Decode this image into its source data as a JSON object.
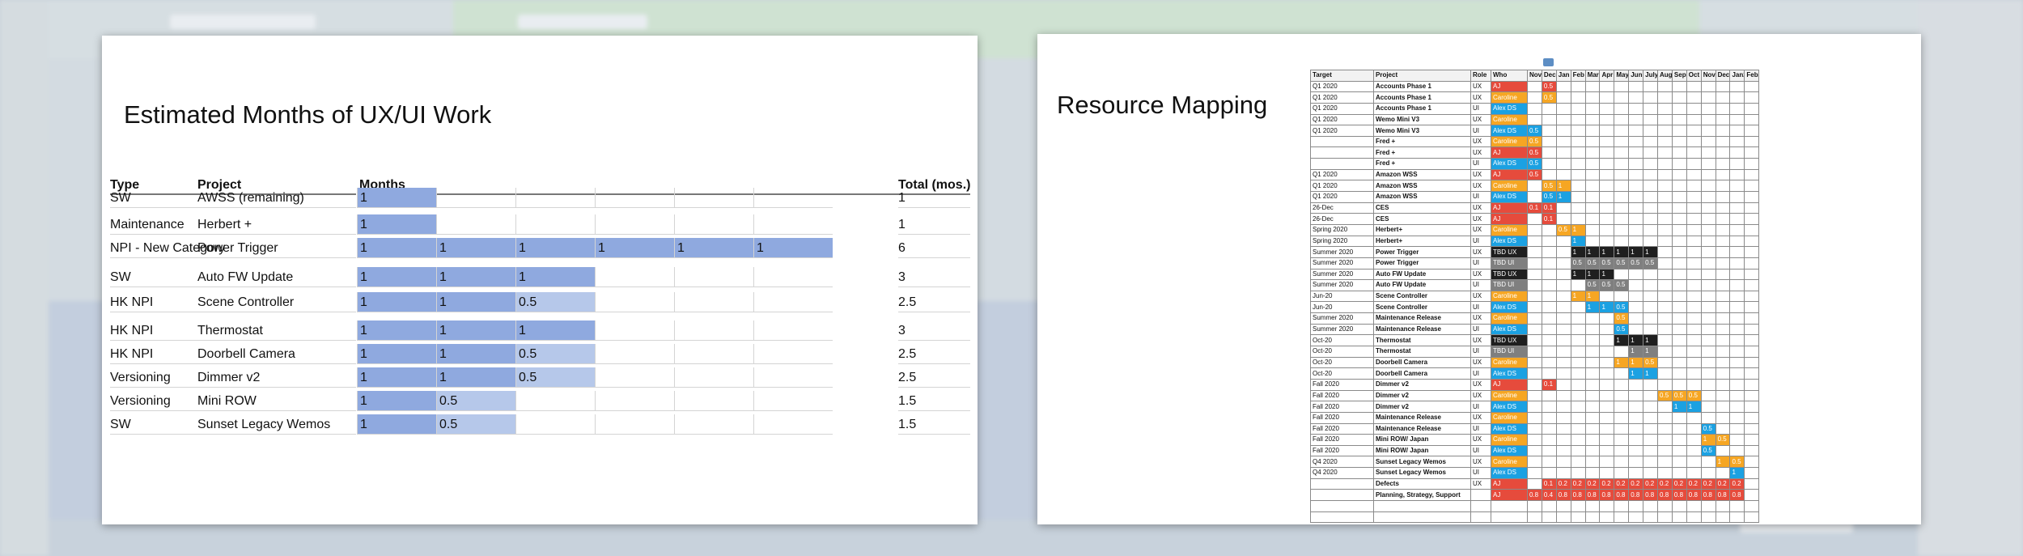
{
  "colors": {
    "red": "#e64b3c",
    "orange": "#f6a623",
    "blue": "#1ba1e2",
    "black": "#1f1f1f",
    "gray": "#7f7f7f",
    "month_full": "#8fa9df",
    "month_half": "#b6c8ea"
  },
  "icons": {
    "table_handle": "table-handle-icon"
  },
  "left_slide": {
    "title": "Estimated Months of UX/UI Work",
    "headers": {
      "type": "Type",
      "project": "Project",
      "months": "Months",
      "total": "Total (mos.)"
    },
    "rows": [
      {
        "type": "SW",
        "project": "AWSS (remaining)",
        "months": [
          "1"
        ],
        "total": "1"
      },
      {
        "type": "Maintenance",
        "project": "Herbert +",
        "months": [
          "1"
        ],
        "total": "1"
      },
      {
        "type": "NPI - New Category",
        "project": "Power Trigger",
        "months": [
          "1",
          "1",
          "1",
          "1",
          "1",
          "1"
        ],
        "total": "6"
      },
      {
        "type": "SW",
        "project": "Auto FW Update",
        "months": [
          "1",
          "1",
          "1"
        ],
        "total": "3"
      },
      {
        "type": "HK NPI",
        "project": "Scene Controller",
        "months": [
          "1",
          "1",
          "0.5"
        ],
        "total": "2.5"
      },
      {
        "type": "HK NPI",
        "project": "Thermostat",
        "months": [
          "1",
          "1",
          "1"
        ],
        "total": "3"
      },
      {
        "type": "HK NPI",
        "project": "Doorbell Camera",
        "months": [
          "1",
          "1",
          "0.5"
        ],
        "total": "2.5"
      },
      {
        "type": "Versioning",
        "project": "Dimmer v2",
        "months": [
          "1",
          "1",
          "0.5"
        ],
        "total": "2.5"
      },
      {
        "type": "Versioning",
        "project": "Mini ROW",
        "months": [
          "1",
          "0.5"
        ],
        "total": "1.5"
      },
      {
        "type": "SW",
        "project": "Sunset Legacy Wemos",
        "months": [
          "1",
          "0.5"
        ],
        "total": "1.5"
      }
    ]
  },
  "right_slide": {
    "title": "Resource Mapping",
    "headers": {
      "target": "Target",
      "project": "Project",
      "role": "Role",
      "who": "Who"
    },
    "months": [
      "Nov",
      "Dec",
      "Jan",
      "Feb",
      "Mar",
      "Apr",
      "May",
      "Jun",
      "July",
      "Aug",
      "Sep",
      "Oct",
      "Nov2",
      "Dec2",
      "Jan2",
      "Feb2"
    ],
    "rows": [
      {
        "target": "Q1 2020",
        "project": "Accounts Phase 1",
        "role": "UX",
        "who": "AJ",
        "whoColor": "red",
        "cells": [
          [
            "Dec",
            "0.5",
            "red"
          ]
        ]
      },
      {
        "target": "Q1 2020",
        "project": "Accounts Phase 1",
        "role": "UX",
        "who": "Caroline",
        "whoColor": "orange",
        "cells": [
          [
            "Dec",
            "0.5",
            "orange"
          ]
        ]
      },
      {
        "target": "Q1 2020",
        "project": "Accounts Phase 1",
        "role": "UI",
        "who": "Alex DS",
        "whoColor": "blue",
        "cells": []
      },
      {
        "target": "Q1 2020",
        "project": "Wemo Mini V3",
        "role": "UX",
        "who": "Caroline",
        "whoColor": "orange",
        "cells": []
      },
      {
        "target": "Q1 2020",
        "project": "Wemo Mini V3",
        "role": "UI",
        "who": "Alex DS",
        "whoColor": "blue",
        "cells": [
          [
            "Nov",
            "0.5",
            "blue"
          ]
        ]
      },
      {
        "target": "",
        "project": "Fred +",
        "role": "UX",
        "who": "Caroline",
        "whoColor": "orange",
        "cells": [
          [
            "Nov",
            "0.5",
            "orange"
          ]
        ]
      },
      {
        "target": "",
        "project": "Fred +",
        "role": "UX",
        "who": "AJ",
        "whoColor": "red",
        "cells": [
          [
            "Nov",
            "0.5",
            "red"
          ]
        ]
      },
      {
        "target": "",
        "project": "Fred +",
        "role": "UI",
        "who": "Alex DS",
        "whoColor": "blue",
        "cells": [
          [
            "Nov",
            "0.5",
            "blue"
          ]
        ]
      },
      {
        "target": "Q1 2020",
        "project": "Amazon WSS",
        "role": "UX",
        "who": "AJ",
        "whoColor": "red",
        "cells": [
          [
            "Nov",
            "0.5",
            "red"
          ]
        ]
      },
      {
        "target": "Q1 2020",
        "project": "Amazon WSS",
        "role": "UX",
        "who": "Caroline",
        "whoColor": "orange",
        "cells": [
          [
            "Dec",
            "0.5",
            "orange"
          ],
          [
            "Jan",
            "1",
            "orange"
          ]
        ]
      },
      {
        "target": "Q1 2020",
        "project": "Amazon WSS",
        "role": "UI",
        "who": "Alex DS",
        "whoColor": "blue",
        "cells": [
          [
            "Dec",
            "0.5",
            "blue"
          ],
          [
            "Jan",
            "1",
            "blue"
          ]
        ]
      },
      {
        "target": "26-Dec",
        "project": "CES",
        "role": "UX",
        "who": "AJ",
        "whoColor": "red",
        "cells": [
          [
            "Nov",
            "0.1",
            "red"
          ],
          [
            "Dec",
            "0.1",
            "red"
          ]
        ]
      },
      {
        "target": "26-Dec",
        "project": "CES",
        "role": "UX",
        "who": "AJ",
        "whoColor": "red",
        "cells": [
          [
            "Dec",
            "0.1",
            "red"
          ]
        ]
      },
      {
        "target": "Spring 2020",
        "project": "Herbert+",
        "role": "UX",
        "who": "Caroline",
        "whoColor": "orange",
        "cells": [
          [
            "Jan",
            "0.5",
            "orange"
          ],
          [
            "Feb",
            "1",
            "orange"
          ]
        ]
      },
      {
        "target": "Spring 2020",
        "project": "Herbert+",
        "role": "UI",
        "who": "Alex DS",
        "whoColor": "blue",
        "cells": [
          [
            "Feb",
            "1",
            "blue"
          ]
        ]
      },
      {
        "target": "Summer 2020",
        "project": "Power Trigger",
        "role": "UX",
        "who": "TBD UX",
        "whoColor": "black",
        "cells": [
          [
            "Feb",
            "1",
            "black"
          ],
          [
            "Mar",
            "1",
            "black"
          ],
          [
            "Apr",
            "1",
            "black"
          ],
          [
            "May",
            "1",
            "black"
          ],
          [
            "Jun",
            "1",
            "black"
          ],
          [
            "July",
            "1",
            "black"
          ]
        ]
      },
      {
        "target": "Summer 2020",
        "project": "Power Trigger",
        "role": "UI",
        "who": "TBD UI",
        "whoColor": "gray",
        "cells": [
          [
            "Feb",
            "0.5",
            "gray"
          ],
          [
            "Mar",
            "0.5",
            "gray"
          ],
          [
            "Apr",
            "0.5",
            "gray"
          ],
          [
            "May",
            "0.5",
            "gray"
          ],
          [
            "Jun",
            "0.5",
            "gray"
          ],
          [
            "July",
            "0.5",
            "gray"
          ]
        ]
      },
      {
        "target": "Summer 2020",
        "project": "Auto FW Update",
        "role": "UX",
        "who": "TBD UX",
        "whoColor": "black",
        "cells": [
          [
            "Feb",
            "1",
            "black"
          ],
          [
            "Mar",
            "1",
            "black"
          ],
          [
            "Apr",
            "1",
            "black"
          ]
        ]
      },
      {
        "target": "Summer 2020",
        "project": "Auto FW Update",
        "role": "UI",
        "who": "TBD UI",
        "whoColor": "gray",
        "cells": [
          [
            "Mar",
            "0.5",
            "gray"
          ],
          [
            "Apr",
            "0.5",
            "gray"
          ],
          [
            "May",
            "0.5",
            "gray"
          ]
        ]
      },
      {
        "target": "Jun-20",
        "project": "Scene Controller",
        "role": "UX",
        "who": "Caroline",
        "whoColor": "orange",
        "cells": [
          [
            "Feb",
            "1",
            "orange"
          ],
          [
            "Mar",
            "1",
            "orange"
          ]
        ]
      },
      {
        "target": "Jun-20",
        "project": "Scene Controller",
        "role": "UI",
        "who": "Alex DS",
        "whoColor": "blue",
        "cells": [
          [
            "Mar",
            "1",
            "blue"
          ],
          [
            "Apr",
            "1",
            "blue"
          ],
          [
            "May",
            "0.5",
            "blue"
          ]
        ]
      },
      {
        "target": "Summer 2020",
        "project": "Maintenance Release",
        "role": "UX",
        "who": "Caroline",
        "whoColor": "orange",
        "cells": [
          [
            "May",
            "0.5",
            "orange"
          ]
        ]
      },
      {
        "target": "Summer 2020",
        "project": "Maintenance Release",
        "role": "UI",
        "who": "Alex DS",
        "whoColor": "blue",
        "cells": [
          [
            "May",
            "0.5",
            "blue"
          ]
        ]
      },
      {
        "target": "Oct-20",
        "project": "Thermostat",
        "role": "UX",
        "who": "TBD UX",
        "whoColor": "black",
        "cells": [
          [
            "May",
            "1",
            "black"
          ],
          [
            "Jun",
            "1",
            "black"
          ],
          [
            "July",
            "1",
            "black"
          ]
        ]
      },
      {
        "target": "Oct-20",
        "project": "Thermostat",
        "role": "UI",
        "who": "TBD UI",
        "whoColor": "gray",
        "cells": [
          [
            "Jun",
            "1",
            "gray"
          ],
          [
            "July",
            "1",
            "gray"
          ]
        ]
      },
      {
        "target": "Oct-20",
        "project": "Doorbell Camera",
        "role": "UX",
        "who": "Caroline",
        "whoColor": "orange",
        "cells": [
          [
            "May",
            "1",
            "orange"
          ],
          [
            "Jun",
            "1",
            "orange"
          ],
          [
            "July",
            "0.5",
            "orange"
          ]
        ]
      },
      {
        "target": "Oct-20",
        "project": "Doorbell Camera",
        "role": "UI",
        "who": "Alex DS",
        "whoColor": "blue",
        "cells": [
          [
            "Jun",
            "1",
            "blue"
          ],
          [
            "July",
            "1",
            "blue"
          ]
        ]
      },
      {
        "target": "Fall 2020",
        "project": "Dimmer v2",
        "role": "UX",
        "who": "AJ",
        "whoColor": "red",
        "cells": [
          [
            "Dec",
            "0.1",
            "red"
          ]
        ]
      },
      {
        "target": "Fall 2020",
        "project": "Dimmer v2",
        "role": "UX",
        "who": "Caroline",
        "whoColor": "orange",
        "cells": [
          [
            "Aug",
            "0.5",
            "orange"
          ],
          [
            "Sep",
            "0.5",
            "orange"
          ],
          [
            "Oct",
            "0.5",
            "orange"
          ]
        ]
      },
      {
        "target": "Fall 2020",
        "project": "Dimmer v2",
        "role": "UI",
        "who": "Alex DS",
        "whoColor": "blue",
        "cells": [
          [
            "Sep",
            "1",
            "blue"
          ],
          [
            "Oct",
            "1",
            "blue"
          ]
        ]
      },
      {
        "target": "Fall 2020",
        "project": "Maintenance Release",
        "role": "UX",
        "who": "Caroline",
        "whoColor": "orange",
        "cells": []
      },
      {
        "target": "Fall 2020",
        "project": "Maintenance Release",
        "role": "UI",
        "who": "Alex DS",
        "whoColor": "blue",
        "cells": [
          [
            "Nov2",
            "0.5",
            "blue"
          ]
        ]
      },
      {
        "target": "Fall 2020",
        "project": "Mini ROW/ Japan",
        "role": "UX",
        "who": "Caroline",
        "whoColor": "orange",
        "cells": [
          [
            "Nov2",
            "1",
            "orange"
          ],
          [
            "Dec2",
            "0.5",
            "orange"
          ]
        ]
      },
      {
        "target": "Fall 2020",
        "project": "Mini ROW/ Japan",
        "role": "UI",
        "who": "Alex DS",
        "whoColor": "blue",
        "cells": [
          [
            "Nov2",
            "0.5",
            "blue"
          ]
        ]
      },
      {
        "target": "Q4 2020",
        "project": "Sunset Legacy Wemos",
        "role": "UX",
        "who": "Caroline",
        "whoColor": "orange",
        "cells": [
          [
            "Dec2",
            "1",
            "orange"
          ],
          [
            "Jan2",
            "0.5",
            "orange"
          ]
        ]
      },
      {
        "target": "Q4 2020",
        "project": "Sunset Legacy Wemos",
        "role": "UI",
        "who": "Alex DS",
        "whoColor": "blue",
        "cells": [
          [
            "Jan2",
            "1",
            "blue"
          ]
        ]
      },
      {
        "target": "",
        "project": "Defects",
        "role": "UX",
        "who": "AJ",
        "whoColor": "red",
        "cells": [
          [
            "Dec",
            "0.1",
            "red"
          ],
          [
            "Jan",
            "0.2",
            "red"
          ],
          [
            "Feb",
            "0.2",
            "red"
          ],
          [
            "Mar",
            "0.2",
            "red"
          ],
          [
            "Apr",
            "0.2",
            "red"
          ],
          [
            "May",
            "0.2",
            "red"
          ],
          [
            "Jun",
            "0.2",
            "red"
          ],
          [
            "July",
            "0.2",
            "red"
          ],
          [
            "Aug",
            "0.2",
            "red"
          ],
          [
            "Sep",
            "0.2",
            "red"
          ],
          [
            "Oct",
            "0.2",
            "red"
          ],
          [
            "Nov2",
            "0.2",
            "red"
          ],
          [
            "Dec2",
            "0.2",
            "red"
          ],
          [
            "Jan2",
            "0.2",
            "red"
          ]
        ]
      },
      {
        "target": "",
        "project": "Planning, Strategy, Support",
        "role": "",
        "who": "AJ",
        "whoColor": "red",
        "cells": [
          [
            "Nov",
            "0.8",
            "red"
          ],
          [
            "Dec",
            "0.4",
            "red"
          ],
          [
            "Jan",
            "0.8",
            "red"
          ],
          [
            "Feb",
            "0.8",
            "red"
          ],
          [
            "Mar",
            "0.8",
            "red"
          ],
          [
            "Apr",
            "0.8",
            "red"
          ],
          [
            "May",
            "0.8",
            "red"
          ],
          [
            "Jun",
            "0.8",
            "red"
          ],
          [
            "July",
            "0.8",
            "red"
          ],
          [
            "Aug",
            "0.8",
            "red"
          ],
          [
            "Sep",
            "0.8",
            "red"
          ],
          [
            "Oct",
            "0.8",
            "red"
          ],
          [
            "Nov2",
            "0.8",
            "red"
          ],
          [
            "Dec2",
            "0.8",
            "red"
          ],
          [
            "Jan2",
            "0.8",
            "red"
          ]
        ]
      },
      {
        "target": "",
        "project": "",
        "role": "",
        "who": "",
        "whoColor": "",
        "cells": []
      },
      {
        "target": "",
        "project": "",
        "role": "",
        "who": "",
        "whoColor": "",
        "cells": []
      }
    ]
  }
}
